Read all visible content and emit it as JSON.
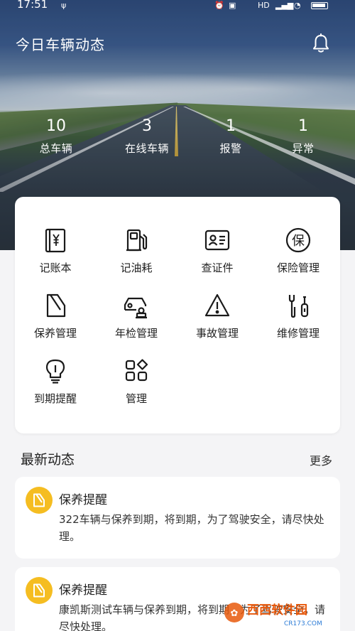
{
  "status": {
    "time": "17:51"
  },
  "header": {
    "title": "今日车辆动态"
  },
  "stats": [
    {
      "value": "10",
      "label": "总车辆"
    },
    {
      "value": "3",
      "label": "在线车辆"
    },
    {
      "value": "1",
      "label": "报警"
    },
    {
      "value": "1",
      "label": "异常"
    }
  ],
  "menu": [
    {
      "label": "记账本",
      "icon": "ledger-icon"
    },
    {
      "label": "记油耗",
      "icon": "fuel-pump-icon"
    },
    {
      "label": "查证件",
      "icon": "id-card-icon"
    },
    {
      "label": "保险管理",
      "icon": "insurance-icon"
    },
    {
      "label": "保养管理",
      "icon": "maintenance-doc-icon"
    },
    {
      "label": "年检管理",
      "icon": "car-inspection-icon"
    },
    {
      "label": "事故管理",
      "icon": "warning-triangle-icon"
    },
    {
      "label": "维修管理",
      "icon": "repair-tools-icon"
    },
    {
      "label": "到期提醒",
      "icon": "lightbulb-icon"
    },
    {
      "label": "管理",
      "icon": "grid-manage-icon"
    }
  ],
  "insurance_glyph": "保",
  "news": {
    "section_title": "最新动态",
    "more_label": "更多",
    "items": [
      {
        "title": "保养提醒",
        "body": "322车辆与保养到期，将到期，为了驾驶安全，请尽快处理。"
      },
      {
        "title": "保养提醒",
        "body": "康凯斯测试车辆与保养到期，将到期，为了驾驶安全，请尽快处理。"
      }
    ]
  },
  "watermark": {
    "text": "西西软件园",
    "sub": "CR173.COM"
  },
  "colors": {
    "accent": "#f5bd21",
    "icon": "#1a1a1a"
  }
}
